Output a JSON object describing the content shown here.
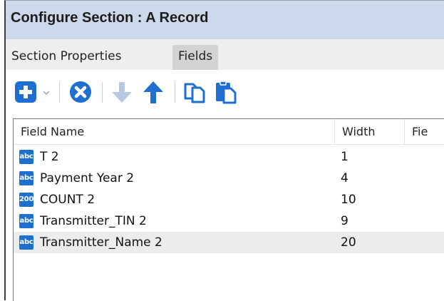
{
  "window": {
    "title": "Configure Section : A Record"
  },
  "tabs": [
    {
      "label": "Section Properties",
      "active": false
    },
    {
      "label": "Fields",
      "active": true
    }
  ],
  "toolbar": {
    "buttons": [
      {
        "name": "add-field",
        "icon": "plus-square-icon",
        "color": "#1f6fd1",
        "enabled": true
      },
      {
        "name": "add-dropdown",
        "icon": "chevron-down-icon",
        "enabled": false
      },
      {
        "name": "delete-field",
        "icon": "x-circle-icon",
        "color": "#1f6fd1",
        "enabled": true
      },
      {
        "name": "move-down",
        "icon": "arrow-down-icon",
        "enabled": false
      },
      {
        "name": "move-up",
        "icon": "arrow-up-icon",
        "color": "#1f6fd1",
        "enabled": true
      },
      {
        "name": "copy",
        "icon": "copy-icon",
        "enabled": true
      },
      {
        "name": "paste",
        "icon": "paste-icon",
        "enabled": true
      }
    ]
  },
  "grid": {
    "columns": [
      "Field Name",
      "Width",
      "Fie"
    ],
    "rows": [
      {
        "type": "abc",
        "name": "T 2",
        "width": "1",
        "selected": false
      },
      {
        "type": "abc",
        "name": "Payment Year 2",
        "width": "4",
        "selected": false
      },
      {
        "type": "200",
        "name": "COUNT 2",
        "width": "10",
        "selected": false
      },
      {
        "type": "abc",
        "name": "Transmitter_TIN 2",
        "width": "9",
        "selected": false
      },
      {
        "type": "abc",
        "name": "Transmitter_Name 2",
        "width": "20",
        "selected": true
      }
    ]
  },
  "colors": {
    "title_bar": "#ccd9eb",
    "accent": "#1f6fd1",
    "disabled": "#b7c8e3",
    "active_tab": "#d3d3d3",
    "selected_row": "#ececec"
  }
}
